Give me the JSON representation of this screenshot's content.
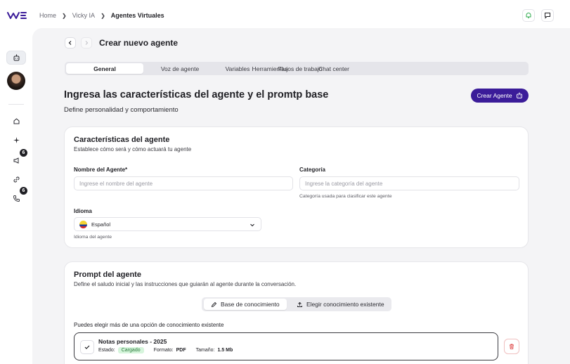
{
  "header": {
    "logo": "WE",
    "breadcrumb": [
      "Home",
      "Vicky IA",
      "Agentes Virtuales"
    ],
    "icons": [
      "bell-icon",
      "chat-icon"
    ]
  },
  "sidebar": {
    "items": [
      {
        "icon": "bot-icon",
        "active": true
      },
      {
        "icon": "home-icon"
      },
      {
        "icon": "sparkle-icon"
      },
      {
        "icon": "megaphone-icon",
        "badge": "6"
      },
      {
        "icon": "link-icon"
      },
      {
        "icon": "phone-icon",
        "badge": "6"
      }
    ]
  },
  "page": {
    "title": "Crear nuevo agente",
    "tabs": [
      "General",
      "Voz de agente",
      "Variables",
      "Herramientas",
      "Flujos de trabajo",
      "Chat center"
    ],
    "heading": "Ingresa las características del agente y el promtp base",
    "subheading": "Define personalidad y comportamiento",
    "create_button": "Crear Agente"
  },
  "characteristics": {
    "title": "Características del agente",
    "subtitle": "Establece cómo será y cómo actuará tu agente",
    "name_label": "Nombre del Agente*",
    "name_placeholder": "Ingrese el nombre del agente",
    "category_label": "Categoría",
    "category_placeholder": "Ingrese la categoría del agente",
    "category_hint": "Categoría usada para clasificar este agente",
    "language_label": "Idioma",
    "language_value": "Español",
    "language_hint": "Idioma del agente"
  },
  "prompt": {
    "title": "Prompt del agente",
    "subtitle": "Define el saludo inicial y las instrucciones que guiarán al agente durante la conversación.",
    "segments": [
      "Base de conocimiento",
      "Elegir conocimiento existente"
    ],
    "multi_note": "Puedes elegir más de una opción de conocimiento existente",
    "file": {
      "name": "Notas personales - 2025",
      "status_label": "Estado:",
      "status_value": "Cargado",
      "format_label": "Formato:",
      "format_value": "PDF",
      "size_label": "Tamaño:",
      "size_value": "1.5 Mb"
    }
  },
  "colors": {
    "accent": "#3b1c99",
    "status_green_bg": "#d6f5dc",
    "status_green_text": "#2a7a3b",
    "danger": "#e05252"
  }
}
